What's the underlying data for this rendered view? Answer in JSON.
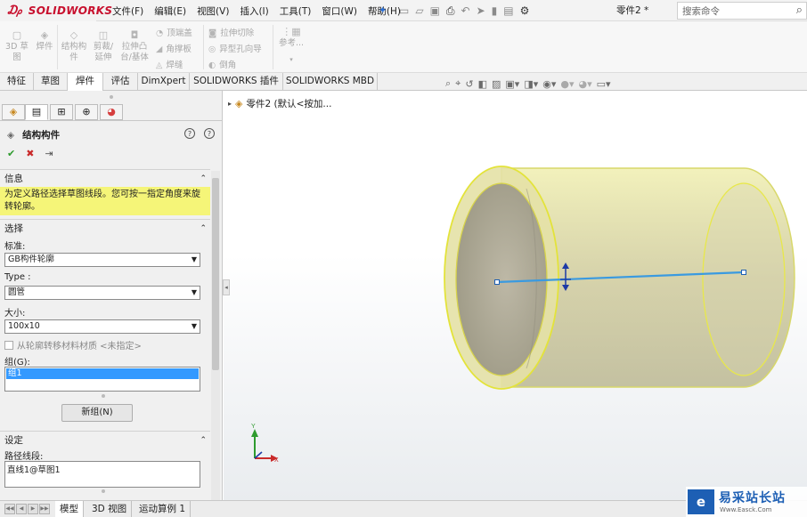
{
  "app": {
    "name": "SOLIDWORKS"
  },
  "menus": [
    "文件(F)",
    "编辑(E)",
    "视图(V)",
    "插入(I)",
    "工具(T)",
    "窗口(W)",
    "帮助(H)"
  ],
  "document_name": "零件2 *",
  "search": {
    "placeholder": "搜索命令"
  },
  "commands": {
    "sketch3d": "3D 草图",
    "weldment": "焊件",
    "structural_member": "结构构件",
    "trim_extend": "剪裁/延伸",
    "extruded_boss": "拉伸凸台/基体",
    "end_cap": "顶端盖",
    "gusset": "角撑板",
    "weld_bead": "焊缝",
    "extruded_cut": "拉伸切除",
    "hole_wizard": "异型孔向导",
    "chamfer": "倒角",
    "reference": "参考..."
  },
  "tabs": [
    "特征",
    "草图",
    "焊件",
    "评估",
    "DimXpert",
    "SOLIDWORKS 插件",
    "SOLIDWORKS MBD"
  ],
  "active_tab": "焊件",
  "feature_tree": {
    "root": "零件2 (默认<按加..."
  },
  "property_manager": {
    "title": "结构构件",
    "info_heading": "信息",
    "info_text": "为定义路径选择草图线段。您可按一指定角度来旋转轮廓。",
    "selection_heading": "选择",
    "standard_label": "标准:",
    "standard_value": "GB构件轮廓",
    "type_label": "Type :",
    "type_value": "圆管",
    "size_label": "大小:",
    "size_value": "100x10",
    "transfer_material": "从轮廓转移材料材质 <未指定>",
    "group_label": "组(G):",
    "group_items": [
      "组1"
    ],
    "new_group": "新组(N)",
    "settings_heading": "设定",
    "path_label": "路径线段:",
    "path_items": [
      "直线1@草图1"
    ]
  },
  "bottom_tabs": [
    "模型",
    "3D 视图",
    "运动算例 1"
  ],
  "active_bottom_tab": "模型",
  "watermark": {
    "logo": "e",
    "title": "易采站长站",
    "subtitle": "Www.Easck.Com"
  },
  "colors": {
    "brand_red": "#c8102e",
    "info_yellow": "#f5f578",
    "selection_blue": "#3399ff",
    "pipe_yellow": "#d8d86a",
    "path_line": "#3a9ae0"
  }
}
